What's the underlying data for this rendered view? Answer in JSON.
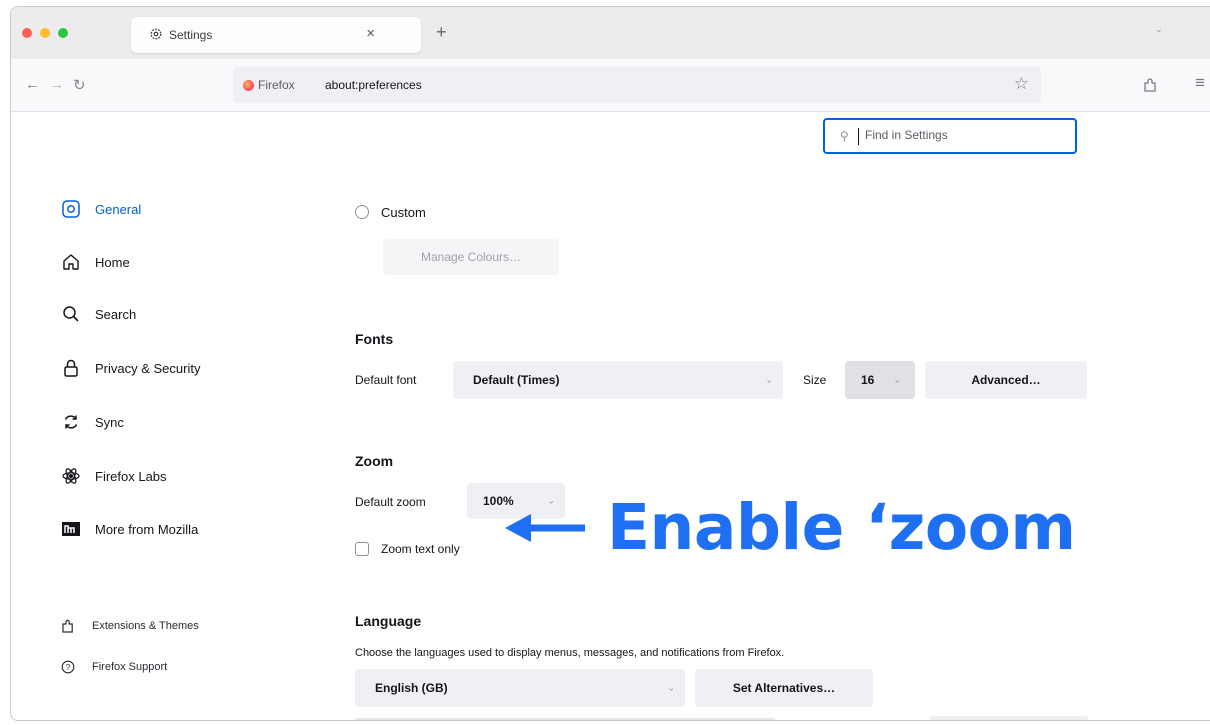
{
  "browser": {
    "tab_title": "Settings",
    "tab_close": "×",
    "new_tab": "+",
    "list_all_tabs": "⌄",
    "url_identity": "Firefox",
    "url": "about:preferences",
    "menu_glyph": "≡",
    "star_glyph": "☆"
  },
  "search": {
    "placeholder": "Find in Settings"
  },
  "sidebar": {
    "items": [
      {
        "label": "General",
        "icon": "gear-icon"
      },
      {
        "label": "Home",
        "icon": "home-icon"
      },
      {
        "label": "Search",
        "icon": "search-icon"
      },
      {
        "label": "Privacy & Security",
        "icon": "lock-icon"
      },
      {
        "label": "Sync",
        "icon": "sync-icon"
      },
      {
        "label": "Firefox Labs",
        "icon": "labs-icon"
      },
      {
        "label": "More from Mozilla",
        "icon": "mozilla-icon"
      }
    ],
    "footer": [
      {
        "label": "Extensions & Themes",
        "icon": "puzzle-icon"
      },
      {
        "label": "Firefox Support",
        "icon": "help-icon"
      }
    ]
  },
  "colours": {
    "custom_label": "Custom",
    "manage_button": "Manage Colours…"
  },
  "fonts": {
    "heading": "Fonts",
    "default_font_label": "Default font",
    "default_font_value": "Default (Times)",
    "size_label": "Size",
    "size_value": "16",
    "advanced_button": "Advanced…"
  },
  "zoom": {
    "heading": "Zoom",
    "default_zoom_label": "Default zoom",
    "default_zoom_value": "100%",
    "zoom_text_only_label": "Zoom text only"
  },
  "language": {
    "heading": "Language",
    "description": "Choose the languages used to display menus, messages, and notifications from Firefox.",
    "value": "English (GB)",
    "set_alternatives_button": "Set Alternatives…"
  },
  "annotation": {
    "text": "Enable ‘zoom"
  },
  "theme": {
    "accent": "#0061e0",
    "annotation": "#1f6ff2"
  }
}
